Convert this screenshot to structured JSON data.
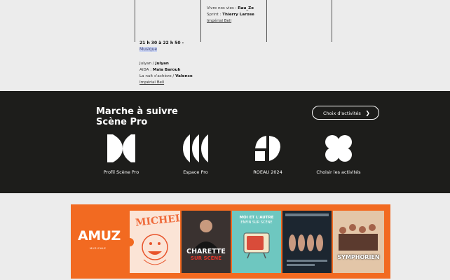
{
  "schedule": {
    "col_a": {
      "time": "21 h 30 à 22 h 50 -",
      "category": "Musique",
      "rows": [
        {
          "label": "Julyan / ",
          "value": "Julyan"
        },
        {
          "label": "AiDA : ",
          "value": "Maïa Barouh"
        },
        {
          "label": "La nuit s'achève / ",
          "value": "Valence"
        }
      ],
      "venue": "Impérial Bell"
    },
    "col_b": {
      "rows": [
        {
          "label": "Vivre nos vies : ",
          "value": "Rau_Ze"
        },
        {
          "label": "Sprint : ",
          "value": "Thierry Larose"
        }
      ],
      "venue": "Impérial Bell"
    }
  },
  "procedure": {
    "title_line1": "Marche à suivre",
    "title_line2": "Scène Pro",
    "button_label": "Choix d'activités",
    "button_icon": "chevron-right-icon",
    "items": [
      {
        "label": "Profil Scène Pro",
        "icon": "profile-icon"
      },
      {
        "label": "Espace Pro",
        "icon": "espace-icon"
      },
      {
        "label": "ROEAU 2024",
        "icon": "roeau-icon"
      },
      {
        "label": "Choisir les activités",
        "icon": "activities-icon"
      }
    ]
  },
  "banner": {
    "brand": "AMUZ",
    "brand_sub": "MUSICALE",
    "accent": "#f26a21",
    "posters": [
      {
        "title": "MICHEL!"
      },
      {
        "title_line1": "CHARETTE",
        "title_line2": "SUR SCÈNE"
      },
      {
        "title_line1": "MOI ET L'AUTRE",
        "title_line2": "ENFIN SUR SCÈNE"
      },
      {
        "title": ""
      },
      {
        "title": "SYMPHORIEN"
      }
    ]
  },
  "colors": {
    "dark_band": "#1d1d1b",
    "page_bg": "#ececec",
    "highlight": "#c9d3f2"
  }
}
